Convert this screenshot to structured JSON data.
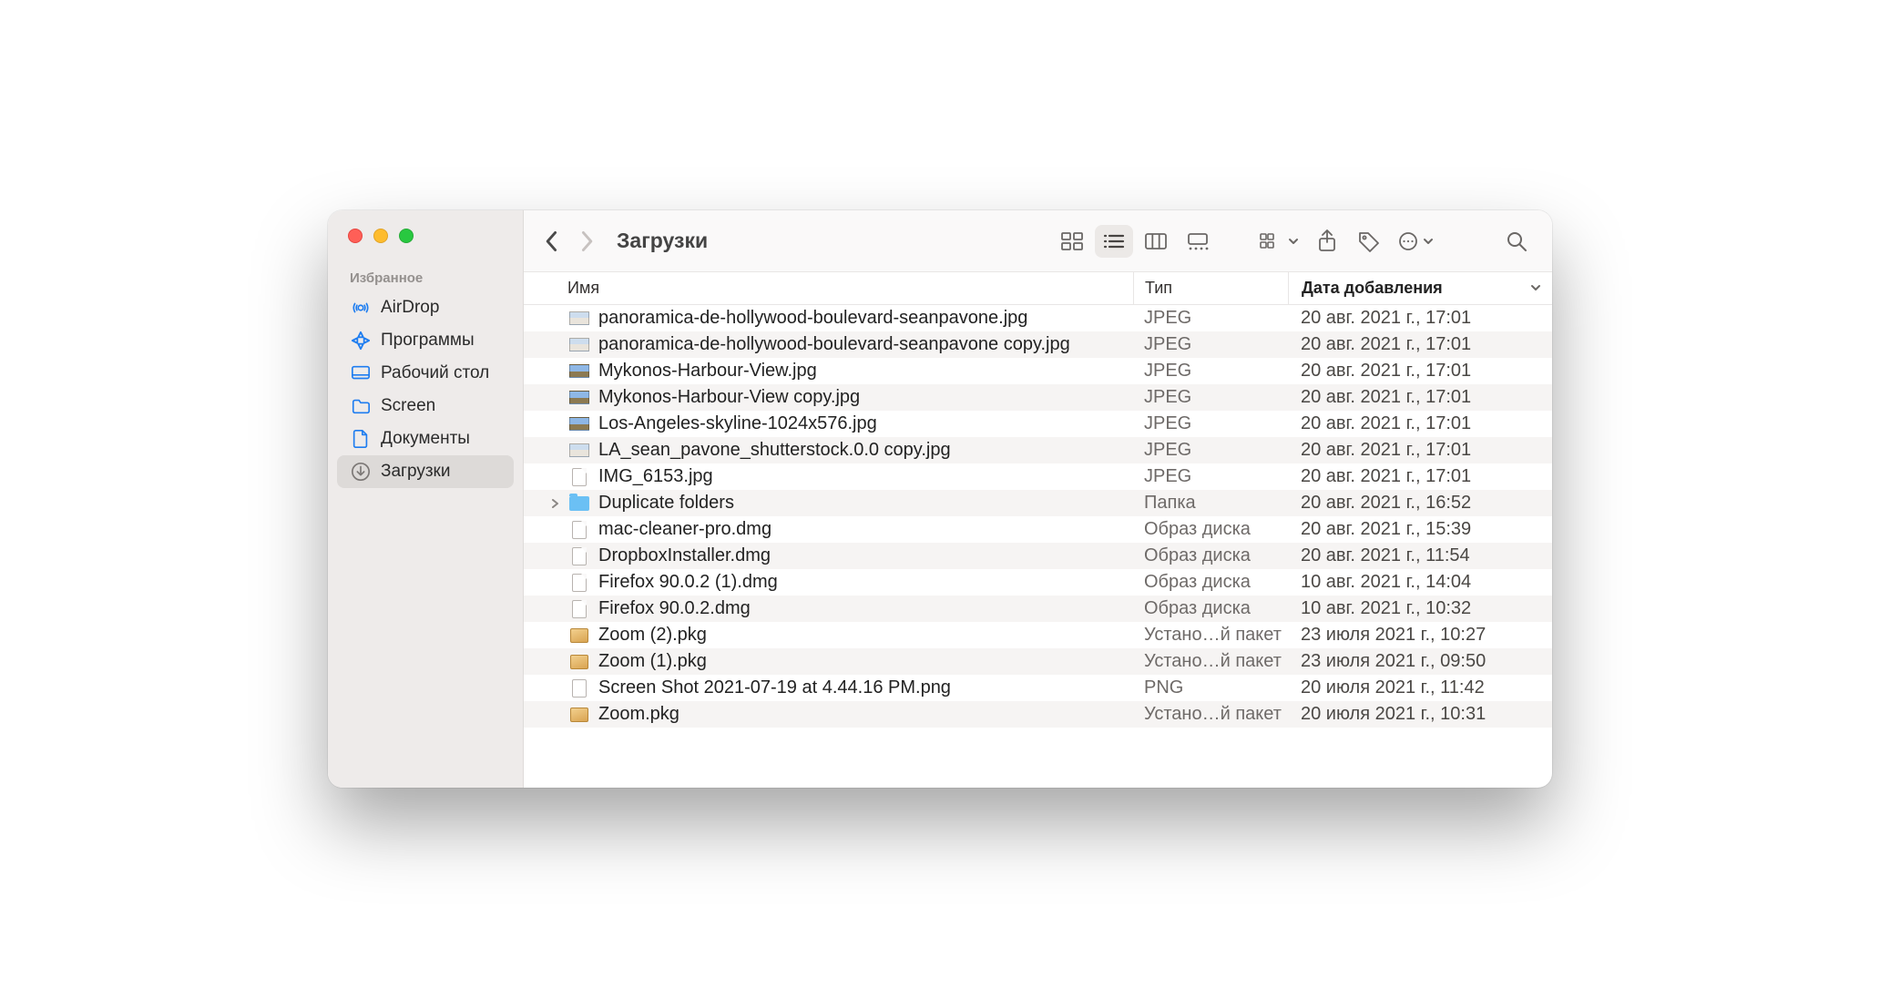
{
  "title": "Загрузки",
  "sidebar": {
    "section_label": "Избранное",
    "items": [
      {
        "label": "AirDrop",
        "icon": "airdrop",
        "selected": false
      },
      {
        "label": "Программы",
        "icon": "apps",
        "selected": false
      },
      {
        "label": "Рабочий стол",
        "icon": "desktop",
        "selected": false
      },
      {
        "label": "Screen",
        "icon": "folder",
        "selected": false
      },
      {
        "label": "Документы",
        "icon": "document",
        "selected": false
      },
      {
        "label": "Загрузки",
        "icon": "download",
        "selected": true
      }
    ]
  },
  "columns": {
    "name": "Имя",
    "type": "Тип",
    "date": "Дата добавления"
  },
  "files": [
    {
      "name": "panoramica-de-hollywood-boulevard-seanpavone.jpg",
      "type": "JPEG",
      "date": "20 авг. 2021 г., 17:01",
      "icon": "photo",
      "disclosure": false
    },
    {
      "name": "panoramica-de-hollywood-boulevard-seanpavone copy.jpg",
      "type": "JPEG",
      "date": "20 авг. 2021 г., 17:01",
      "icon": "photo",
      "disclosure": false
    },
    {
      "name": "Mykonos-Harbour-View.jpg",
      "type": "JPEG",
      "date": "20 авг. 2021 г., 17:01",
      "icon": "sky",
      "disclosure": false
    },
    {
      "name": "Mykonos-Harbour-View copy.jpg",
      "type": "JPEG",
      "date": "20 авг. 2021 г., 17:01",
      "icon": "sky",
      "disclosure": false
    },
    {
      "name": "Los-Angeles-skyline-1024x576.jpg",
      "type": "JPEG",
      "date": "20 авг. 2021 г., 17:01",
      "icon": "sky",
      "disclosure": false
    },
    {
      "name": "LA_sean_pavone_shutterstock.0.0 copy.jpg",
      "type": "JPEG",
      "date": "20 авг. 2021 г., 17:01",
      "icon": "photo",
      "disclosure": false
    },
    {
      "name": "IMG_6153.jpg",
      "type": "JPEG",
      "date": "20 авг. 2021 г., 17:01",
      "icon": "dmg",
      "disclosure": false
    },
    {
      "name": "Duplicate folders",
      "type": "Папка",
      "date": "20 авг. 2021 г., 16:52",
      "icon": "folder",
      "disclosure": true
    },
    {
      "name": "mac-cleaner-pro.dmg",
      "type": "Образ диска",
      "date": "20 авг. 2021 г., 15:39",
      "icon": "dmg",
      "disclosure": false
    },
    {
      "name": "DropboxInstaller.dmg",
      "type": "Образ диска",
      "date": "20 авг. 2021 г., 11:54",
      "icon": "dmg",
      "disclosure": false
    },
    {
      "name": "Firefox 90.0.2 (1).dmg",
      "type": "Образ диска",
      "date": "10 авг. 2021 г., 14:04",
      "icon": "dmg",
      "disclosure": false
    },
    {
      "name": "Firefox 90.0.2.dmg",
      "type": "Образ диска",
      "date": "10 авг. 2021 г., 10:32",
      "icon": "dmg",
      "disclosure": false
    },
    {
      "name": "Zoom (2).pkg",
      "type": "Устано…й пакет",
      "date": "23 июля 2021 г., 10:27",
      "icon": "pkg",
      "disclosure": false
    },
    {
      "name": "Zoom (1).pkg",
      "type": "Устано…й пакет",
      "date": "23 июля 2021 г., 09:50",
      "icon": "pkg",
      "disclosure": false
    },
    {
      "name": "Screen Shot 2021-07-19 at 4.44.16 PM.png",
      "type": "PNG",
      "date": "20 июля 2021 г., 11:42",
      "icon": "png",
      "disclosure": false
    },
    {
      "name": "Zoom.pkg",
      "type": "Устано…й пакет",
      "date": "20 июля 2021 г., 10:31",
      "icon": "pkg",
      "disclosure": false
    }
  ]
}
